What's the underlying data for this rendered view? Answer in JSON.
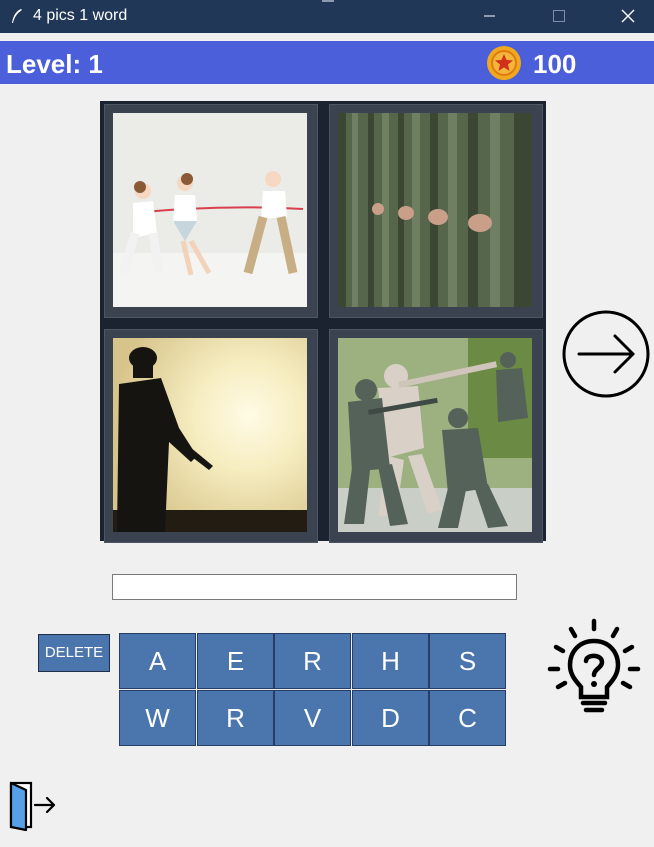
{
  "window": {
    "title": "4 pics 1 word",
    "controls": [
      "minimize-icon",
      "maximize-icon",
      "close-icon"
    ]
  },
  "header": {
    "level_label": "Level: 1",
    "coins": "100",
    "coin_icon": "coin-star-icon"
  },
  "pictures": [
    {
      "name": "tug-of-war-children"
    },
    {
      "name": "soldiers-in-line"
    },
    {
      "name": "soldier-silhouette-sunset"
    },
    {
      "name": "toy-army-men"
    }
  ],
  "answer": {
    "value": ""
  },
  "delete_label": "DELETE",
  "letters": [
    "A",
    "E",
    "R",
    "H",
    "S",
    "W",
    "R",
    "V",
    "D",
    "C"
  ],
  "icons": {
    "next": "arrow-right-circle-icon",
    "hint": "lightbulb-question-icon",
    "exit": "exit-door-icon"
  },
  "colors": {
    "titlebar": "#213757",
    "header": "#4a5fd9",
    "letter_tile": "#4b75ad",
    "background": "#f0f0f0"
  }
}
